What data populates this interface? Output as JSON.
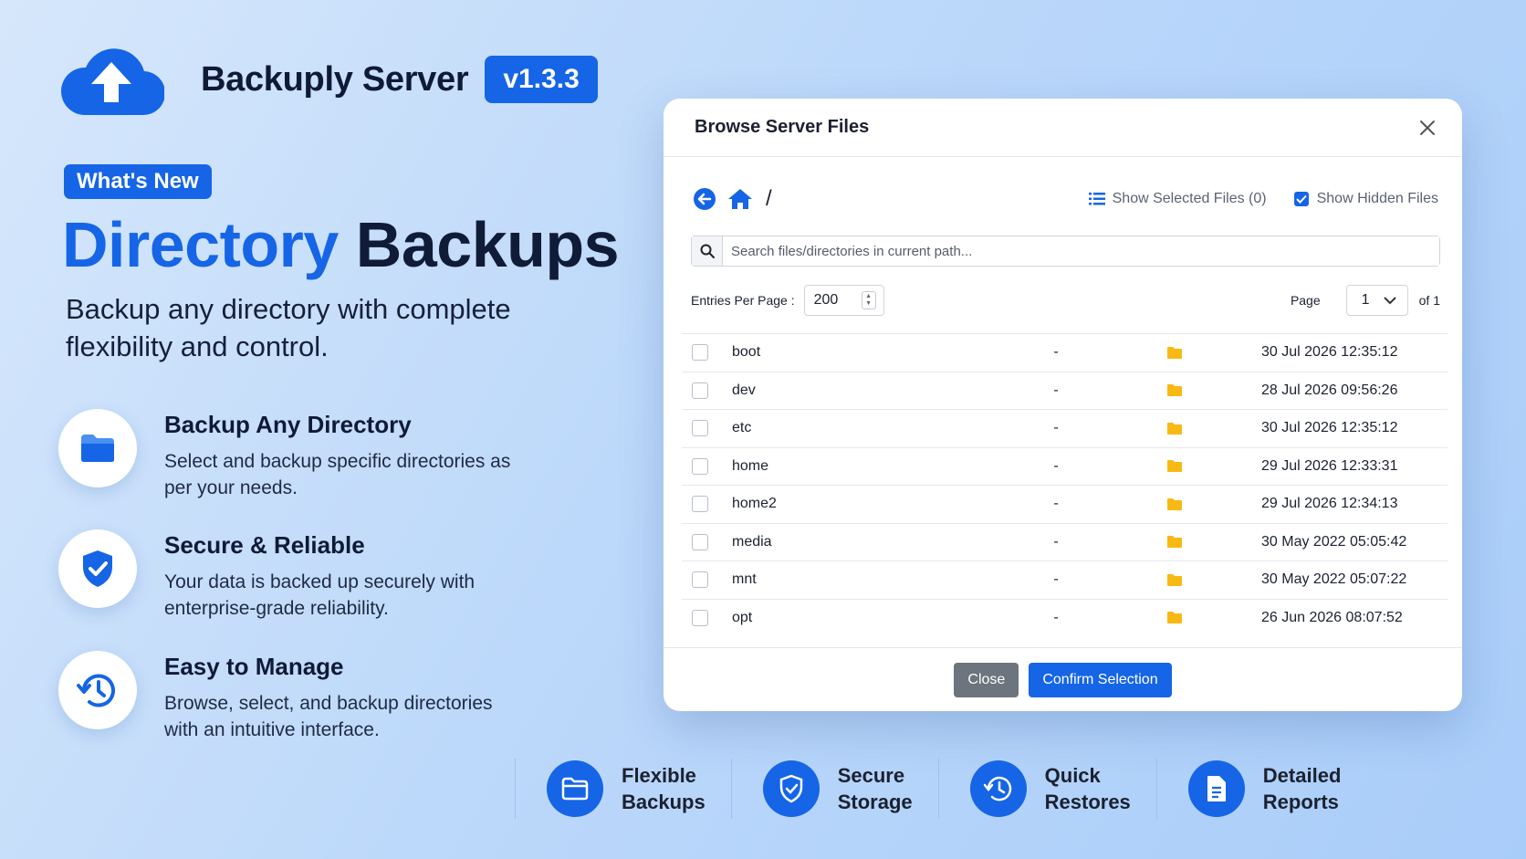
{
  "brand": {
    "name": "Backuply Server",
    "version": "v1.3.3"
  },
  "badge": "What's New",
  "headline": {
    "accent": "Directory",
    "rest": " Backups"
  },
  "subhead": "Backup any directory with complete flexibility and control.",
  "features": [
    {
      "icon": "folder-icon",
      "title": "Backup Any Directory",
      "desc": "Select and backup specific directories as per your needs."
    },
    {
      "icon": "shield-check-icon",
      "title": "Secure & Reliable",
      "desc": "Your data is backed up securely with enterprise-grade reliability."
    },
    {
      "icon": "history-icon",
      "title": "Easy to Manage",
      "desc": "Browse, select, and backup directories with an intuitive interface."
    }
  ],
  "modal": {
    "title": "Browse Server Files",
    "path": "/",
    "show_selected": "Show Selected Files (0)",
    "show_hidden": "Show Hidden Files",
    "search_placeholder": "Search files/directories in current path...",
    "entries_label": "Entries Per Page :",
    "entries_value": "200",
    "page_label": "Page",
    "page_value": "1",
    "page_of": "of 1",
    "close_label": "Close",
    "confirm_label": "Confirm Selection",
    "files": [
      {
        "name": "boot",
        "size": "-",
        "date": "30 Jul 2026 12:35:12"
      },
      {
        "name": "dev",
        "size": "-",
        "date": "28 Jul 2026 09:56:26"
      },
      {
        "name": "etc",
        "size": "-",
        "date": "30 Jul 2026 12:35:12"
      },
      {
        "name": "home",
        "size": "-",
        "date": "29 Jul 2026 12:33:31"
      },
      {
        "name": "home2",
        "size": "-",
        "date": "29 Jul 2026 12:34:13"
      },
      {
        "name": "media",
        "size": "-",
        "date": "30 May 2022 05:05:42"
      },
      {
        "name": "mnt",
        "size": "-",
        "date": "30 May 2022 05:07:22"
      },
      {
        "name": "opt",
        "size": "-",
        "date": "26 Jun 2026 08:07:52"
      }
    ]
  },
  "strip": [
    {
      "icon": "folder-icon",
      "line1": "Flexible",
      "line2": "Backups"
    },
    {
      "icon": "shield-check-icon",
      "line1": "Secure",
      "line2": "Storage"
    },
    {
      "icon": "history-icon",
      "line1": "Quick",
      "line2": "Restores"
    },
    {
      "icon": "document-icon",
      "line1": "Detailed",
      "line2": "Reports"
    }
  ],
  "colors": {
    "accent": "#1565e6",
    "folder": "#f8b914",
    "close_btn": "#6c757d"
  }
}
